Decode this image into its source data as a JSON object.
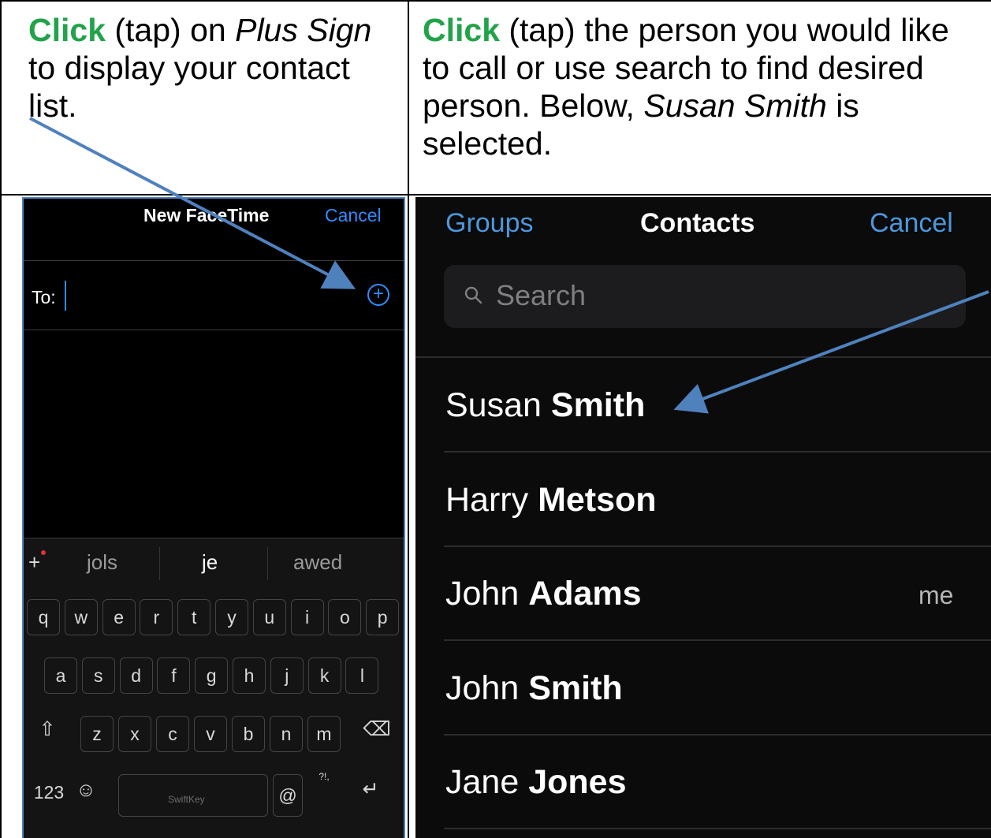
{
  "left_instruction": {
    "click": "Click",
    "t1": " (tap) on ",
    "plus_sign": "Plus Sign",
    "t2": " to display your contact list."
  },
  "right_instruction": {
    "click": "Click",
    "t1": " (tap) the person you would like to call or use search to find desired person. Below, ",
    "name": "Susan Smith",
    "t2": " is selected."
  },
  "facetime": {
    "title": "New FaceTime",
    "cancel": "Cancel",
    "to_label": "To:",
    "plus_icon": "plus-circle-icon",
    "suggestions": [
      "jols",
      "je",
      "awed"
    ],
    "keyboard": {
      "row1": [
        "q",
        "w",
        "e",
        "r",
        "t",
        "y",
        "u",
        "i",
        "o",
        "p"
      ],
      "row2": [
        "a",
        "s",
        "d",
        "f",
        "g",
        "h",
        "j",
        "k",
        "l"
      ],
      "row3": [
        "z",
        "x",
        "c",
        "v",
        "b",
        "n",
        "m"
      ],
      "numbers_key": "123",
      "at_key": "@",
      "punct_key": "?!,",
      "space_brand": "SwiftKey",
      "icons": [
        "shift-icon",
        "backspace-icon",
        "emoji-icon",
        "return-icon"
      ]
    }
  },
  "contacts": {
    "groups": "Groups",
    "title": "Contacts",
    "cancel": "Cancel",
    "search_placeholder": "Search",
    "list": [
      {
        "first": "Susan",
        "last": "Smith",
        "tag": ""
      },
      {
        "first": "Harry",
        "last": "Metson",
        "tag": ""
      },
      {
        "first": "John",
        "last": "Adams",
        "tag": "me"
      },
      {
        "first": "John",
        "last": "Smith",
        "tag": ""
      },
      {
        "first": "Jane",
        "last": "Jones",
        "tag": ""
      }
    ]
  },
  "colors": {
    "click_green": "#22a34a",
    "ios_blue": "#2e8cff",
    "arrow_blue": "#4f81bd"
  }
}
